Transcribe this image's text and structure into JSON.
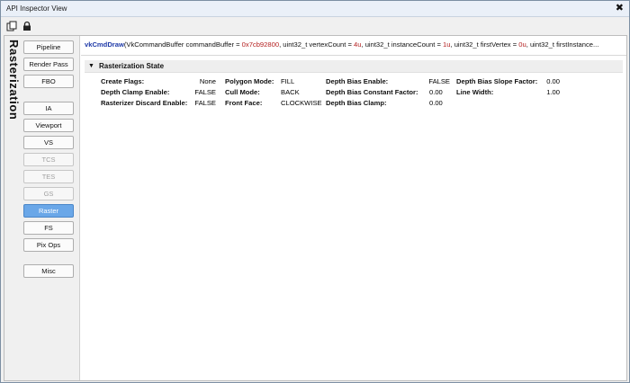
{
  "window": {
    "title": "API Inspector View"
  },
  "toolbar": {
    "icons": [
      "copy-icon",
      "lock-icon"
    ]
  },
  "sidebar": {
    "vertical_label": "Rasterization",
    "buttons": [
      {
        "label": "Pipeline",
        "state": "normal"
      },
      {
        "label": "Render Pass",
        "state": "normal"
      },
      {
        "label": "FBO",
        "state": "normal"
      },
      {
        "label": "IA",
        "state": "normal"
      },
      {
        "label": "Viewport",
        "state": "normal"
      },
      {
        "label": "VS",
        "state": "normal"
      },
      {
        "label": "TCS",
        "state": "disabled"
      },
      {
        "label": "TES",
        "state": "disabled"
      },
      {
        "label": "GS",
        "state": "disabled"
      },
      {
        "label": "Raster",
        "state": "active"
      },
      {
        "label": "FS",
        "state": "normal"
      },
      {
        "label": "Pix Ops",
        "state": "normal"
      },
      {
        "label": "Misc",
        "state": "normal"
      }
    ]
  },
  "call": {
    "fn": "vkCmdDraw",
    "p1_pre": "(VkCommandBuffer commandBuffer = ",
    "p1_val": "0x7cb92800",
    "p2_pre": ", uint32_t vertexCount = ",
    "p2_val": "4u",
    "p3_pre": ", uint32_t instanceCount = ",
    "p3_val": "1u",
    "p4_pre": ", uint32_t firstVertex = ",
    "p4_val": "0u",
    "p5_pre": ", uint32_t firstInstance..."
  },
  "section": {
    "title": "Rasterization State",
    "col1": [
      {
        "label": "Create Flags:",
        "value": "None"
      },
      {
        "label": "Depth Clamp Enable:",
        "value": "FALSE"
      },
      {
        "label": "Rasterizer Discard Enable:",
        "value": "FALSE"
      }
    ],
    "col2": [
      {
        "label": "Polygon Mode:",
        "value": "FILL"
      },
      {
        "label": "Cull Mode:",
        "value": "BACK"
      },
      {
        "label": "Front Face:",
        "value": "CLOCKWISE"
      }
    ],
    "col3": [
      {
        "label": "Depth Bias Enable:",
        "value": "FALSE"
      },
      {
        "label": "Depth Bias Constant Factor:",
        "value": "0.00"
      },
      {
        "label": "Depth Bias Clamp:",
        "value": "0.00"
      }
    ],
    "col4": [
      {
        "label": "Depth Bias Slope Factor:",
        "value": "0.00"
      },
      {
        "label": "Line Width:",
        "value": "1.00"
      }
    ]
  },
  "colors": {
    "accent": "#6aa7e8",
    "fn_blue": "#1f3aa8",
    "value_red": "#b42020"
  }
}
